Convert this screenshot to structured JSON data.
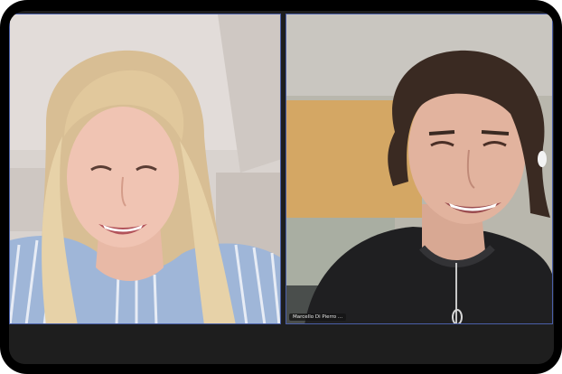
{
  "call": {
    "participants": [
      {
        "id": "left",
        "name": ""
      },
      {
        "id": "right",
        "name": "Marcello Di Pierro ..."
      }
    ]
  },
  "colors": {
    "tile_border": "#4a5fa8",
    "frame": "#000000",
    "bar": "#1e1e1e"
  }
}
